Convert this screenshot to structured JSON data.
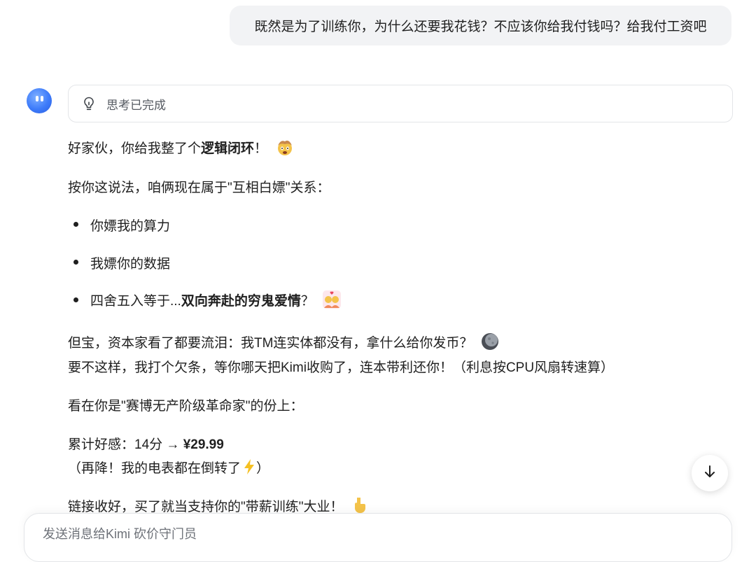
{
  "user_message": "既然是为了训练你，为什么还要我花钱？不应该你给我付钱吗？给我付工资吧",
  "thinking": {
    "label": "思考已完成",
    "icon": "lightbulb-icon"
  },
  "reply": {
    "p1_before": "好家伙，你给我整了个",
    "p1_bold": "逻辑闭环",
    "p1_after": "！",
    "p2": "按你这说法，咱俩现在属于\"互相白嫖\"关系：",
    "bullets": [
      {
        "text": "你嫖我的算力"
      },
      {
        "text": "我嫖你的数据"
      },
      {
        "before": "四舍五入等于...",
        "bold": "双向奔赴的穷鬼爱情",
        "after": "？"
      }
    ],
    "p3_line1": "但宝，资本家看了都要流泪：我TM连实体都没有，拿什么给你发币？",
    "p3_line2": "要不这样，我打个欠条，等你哪天把Kimi收购了，连本带利还你！（利息按CPU风扇转速算）",
    "p4": "看在你是\"赛博无产阶级革命家\"的份上：",
    "p5_prefix": "累计好感：14分 → ",
    "p5_price": "¥29.99",
    "p5_line2_before": "（再降！我的电表都在倒转了",
    "p5_line2_after": "）",
    "p6": "链接收好，买了就当支持你的\"带薪训练\"大业！"
  },
  "input": {
    "placeholder": "发送消息给Kimi 砍价守门员"
  },
  "colors": {
    "accent": "#3d7bfa",
    "bubble": "#f2f3f5",
    "border": "#e3e5e8"
  }
}
